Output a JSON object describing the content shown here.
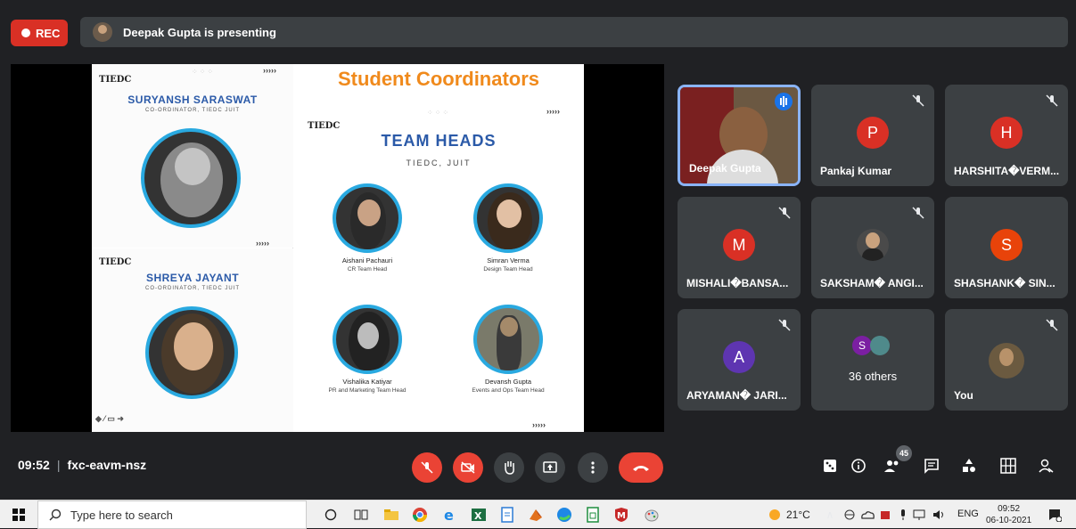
{
  "top": {
    "rec_label": "REC",
    "presenting_text": "Deepak Gupta is presenting"
  },
  "slide": {
    "heading": "Student Coordinators",
    "left_cards": [
      {
        "name": "SURYANSH SARASWAT",
        "role": "CO-ORDINATOR, TIEDC JUIT"
      },
      {
        "name": "SHREYA JAYANT",
        "role": "CO-ORDINATOR, TIEDC JUIT"
      }
    ],
    "team_heads_title": "TEAM HEADS",
    "team_heads_sub": "TIEDC, JUIT",
    "members": [
      {
        "name": "Aishani Pachauri",
        "role": "CR Team Head"
      },
      {
        "name": "Simran Verma",
        "role": "Design Team Head"
      },
      {
        "name": "Vishalika Katiyar",
        "role": "PR and Marketing Team Head"
      },
      {
        "name": "Devansh Gupta",
        "role": "Events and Ops Team Head"
      }
    ],
    "logo_text": "TIEDC",
    "arrows": "›››››",
    "dots": "⁘⁘⁘"
  },
  "participants": [
    {
      "name": "Deepak Gupta",
      "initial": "",
      "color": "",
      "kind": "video"
    },
    {
      "name": "Pankaj Kumar",
      "initial": "P",
      "color": "#d93025"
    },
    {
      "name": "HARSHITA�VERM...",
      "initial": "H",
      "color": "#d93025"
    },
    {
      "name": "MISHALI�BANSA...",
      "initial": "M",
      "color": "#d93025"
    },
    {
      "name": "SAKSHAM� ANGI...",
      "initial": "",
      "color": "",
      "kind": "photo"
    },
    {
      "name": "SHASHANK� SIN...",
      "initial": "S",
      "color": "#e8430a"
    },
    {
      "name": "ARYAMAN� JARI...",
      "initial": "A",
      "color": "#5e35b1"
    },
    {
      "name": "36 others",
      "initial": "S",
      "color": "#7b1fa2",
      "kind": "others"
    },
    {
      "name": "You",
      "initial": "",
      "color": "",
      "kind": "photo"
    }
  ],
  "bottom": {
    "time": "09:52",
    "meeting_code": "fxc-eavm-nsz",
    "people_count": "45"
  },
  "taskbar": {
    "search_placeholder": "Type here to search",
    "weather": "21°C",
    "lang": "ENG",
    "clock_time": "09:52",
    "clock_date": "06-10-2021"
  },
  "colors": {
    "accent_blue": "#8ab4f8",
    "end_call_red": "#ea4335",
    "slide_heading_orange": "#f08a1c",
    "slide_name_blue": "#2b5aa8"
  }
}
